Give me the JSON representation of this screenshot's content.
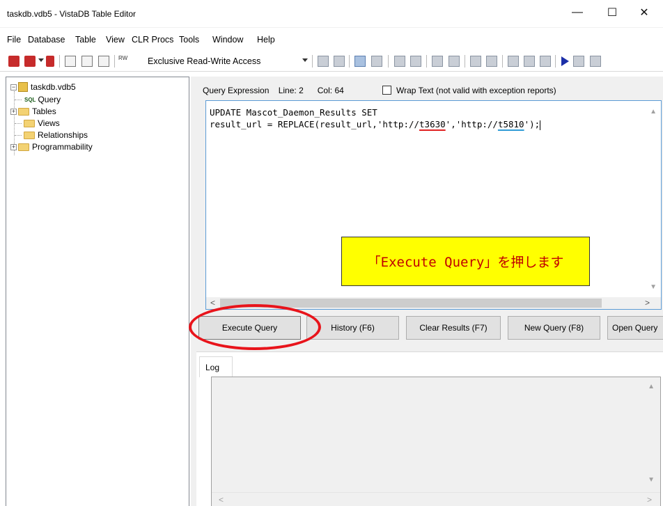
{
  "window": {
    "title": "taskdb.vdb5 - VistaDB Table Editor",
    "minimize_glyph": "—",
    "maximize_glyph": "☐",
    "close_glyph": "✕"
  },
  "menu": {
    "file": "File",
    "database": "Database",
    "table": "Table",
    "view": "View",
    "clr_procs": "CLR Procs",
    "tools": "Tools",
    "window": "Window",
    "help": "Help"
  },
  "toolbar": {
    "access_mode": "Exclusive Read-Write Access",
    "rw_badge": "RW"
  },
  "tree": {
    "root": "taskdb.vdb5",
    "query": "Query",
    "tables": "Tables",
    "views": "Views",
    "relationships": "Relationships",
    "programmability": "Programmability",
    "sql_badge": "SQL"
  },
  "query_header": {
    "label": "Query Expression",
    "line": "Line: 2",
    "col": "Col: 64",
    "wrap_text": "Wrap Text (not valid with exception reports)"
  },
  "editor": {
    "line1": "UPDATE Mascot_Daemon_Results SET",
    "line2_a": "result_url = REPLACE(result_url,'http://",
    "line2_b": "t3630",
    "line2_c": "','http://",
    "line2_d": "t5810",
    "line2_e": "');"
  },
  "annotation": {
    "text": "「Execute Query」を押します"
  },
  "buttons": {
    "execute": "Execute Query",
    "history": "History (F6)",
    "clear": "Clear Results (F7)",
    "new_query": "New Query (F8)",
    "open_query": "Open Query"
  },
  "log": {
    "tab": "Log"
  },
  "colors": {
    "highlight_ellipse": "#e8141b",
    "callout_bg": "#ffff00",
    "callout_text": "#c00000"
  }
}
